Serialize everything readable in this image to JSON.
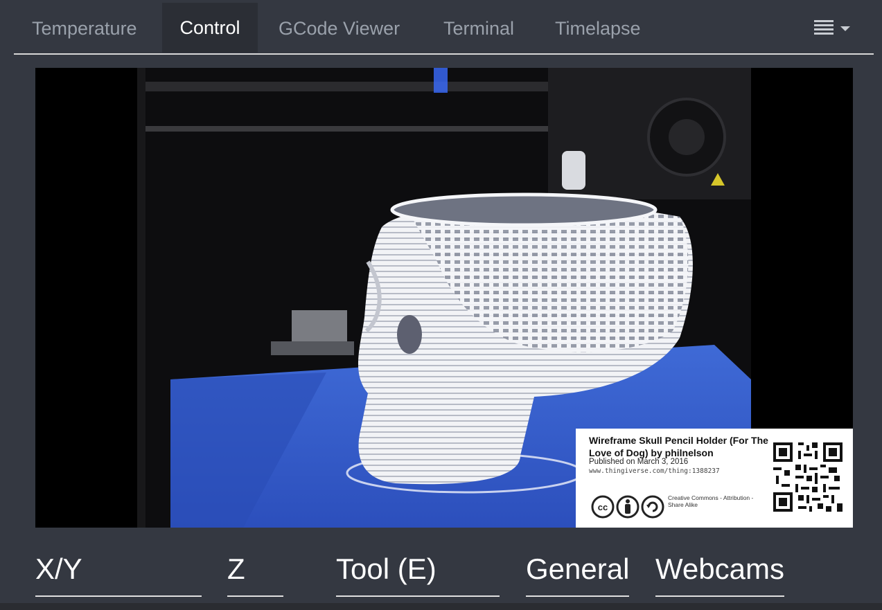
{
  "tabs": [
    {
      "label": "Temperature",
      "active": false
    },
    {
      "label": "Control",
      "active": true
    },
    {
      "label": "GCode Viewer",
      "active": false
    },
    {
      "label": "Terminal",
      "active": false
    },
    {
      "label": "Timelapse",
      "active": false
    }
  ],
  "menu": {
    "icon": "hamburger-list-icon",
    "caret": "caret-down-icon"
  },
  "webcam": {
    "overlay": {
      "title": "Wireframe Skull Pencil Holder (For The Love of Dog) by philnelson",
      "published": "Published on March 3, 2016",
      "url": "www.thingiverse.com/thing:1388237",
      "license": "Creative Commons - Attribution - Share Alike",
      "license_icons": [
        "cc-icon",
        "attribution-icon",
        "share-alike-icon"
      ]
    }
  },
  "sections": [
    {
      "label": "X/Y"
    },
    {
      "label": "Z"
    },
    {
      "label": "Tool (E)"
    },
    {
      "label": "General"
    },
    {
      "label": "Webcams"
    }
  ],
  "colors": {
    "background": "#343841",
    "tab_active_bg": "#2b2e35",
    "tab_inactive_text": "#9aa1ab",
    "print_bed": "#2f57c8"
  }
}
